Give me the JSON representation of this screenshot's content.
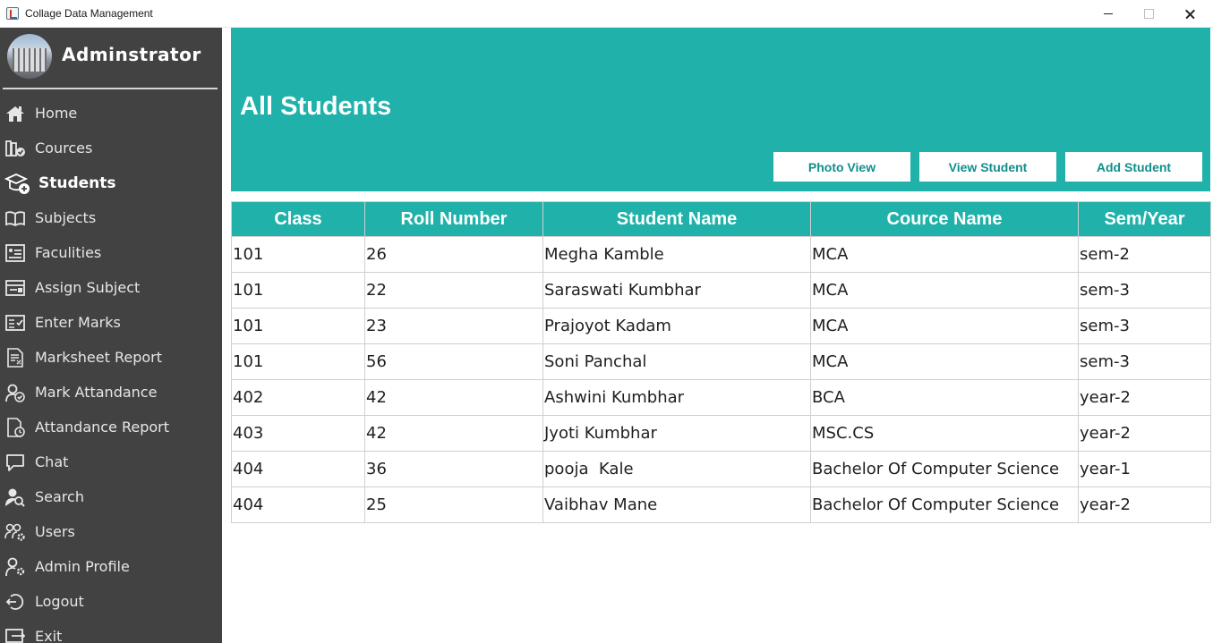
{
  "window": {
    "title": "Collage Data Management"
  },
  "sidebar": {
    "admin_name": "Adminstrator",
    "items": [
      {
        "label": "Home",
        "icon": "home-icon"
      },
      {
        "label": "Cources",
        "icon": "books-icon"
      },
      {
        "label": "Students",
        "icon": "student-add-icon",
        "active": true
      },
      {
        "label": "Subjects",
        "icon": "open-book-icon"
      },
      {
        "label": "Faculities",
        "icon": "faculty-list-icon"
      },
      {
        "label": "Assign Subject",
        "icon": "assign-icon"
      },
      {
        "label": "Enter Marks",
        "icon": "marks-entry-icon"
      },
      {
        "label": "Marksheet Report",
        "icon": "report-doc-icon"
      },
      {
        "label": "Mark Attandance",
        "icon": "user-check-icon"
      },
      {
        "label": "Attandance Report",
        "icon": "doc-clock-icon"
      },
      {
        "label": "Chat",
        "icon": "chat-icon"
      },
      {
        "label": "Search",
        "icon": "user-search-icon"
      },
      {
        "label": "Users",
        "icon": "users-gear-icon"
      },
      {
        "label": "Admin Profile",
        "icon": "user-gear-icon"
      },
      {
        "label": "Logout",
        "icon": "logout-icon"
      },
      {
        "label": "Exit",
        "icon": "exit-icon"
      }
    ]
  },
  "header": {
    "title": "All Students",
    "buttons": {
      "photo_view": "Photo View",
      "view_student": "View Student",
      "add_student": "Add Student"
    }
  },
  "table": {
    "columns": [
      "Class",
      "Roll Number",
      "Student Name",
      "Cource Name",
      "Sem/Year"
    ],
    "rows": [
      [
        "101",
        "26",
        "Megha Kamble",
        "MCA",
        "sem-2"
      ],
      [
        "101",
        "22",
        "Saraswati Kumbhar",
        "MCA",
        "sem-3"
      ],
      [
        "101",
        "23",
        "Prajoyot Kadam",
        "MCA",
        "sem-3"
      ],
      [
        "101",
        "56",
        "Soni Panchal",
        "MCA",
        "sem-3"
      ],
      [
        "402",
        "42",
        "Ashwini Kumbhar",
        "BCA",
        "year-2"
      ],
      [
        "403",
        "42",
        "Jyoti Kumbhar",
        "MSC.CS",
        "year-2"
      ],
      [
        "404",
        "36",
        "pooja  Kale",
        "Bachelor Of Computer Science",
        "year-1"
      ],
      [
        "404",
        "25",
        "Vaibhav Mane",
        "Bachelor Of Computer Science",
        "year-2"
      ]
    ]
  },
  "colors": {
    "accent": "#20b2aa",
    "sidebar_bg": "#424242",
    "button_text": "#0f8f8b"
  }
}
